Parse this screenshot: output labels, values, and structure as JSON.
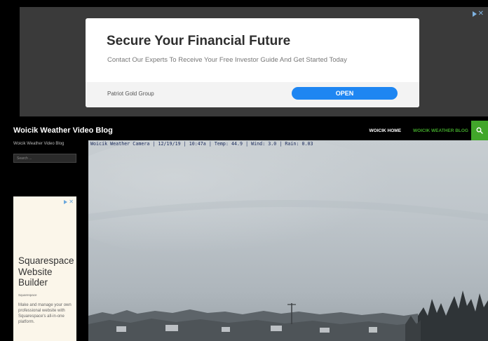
{
  "top_ad": {
    "title": "Secure Your Financial Future",
    "subtitle": "Contact Our Experts To Receive Your Free Investor Guide And Get Started Today",
    "brand": "Patriot Gold Group",
    "cta": "OPEN"
  },
  "header": {
    "site_title": "Woicik Weather Video Blog",
    "nav": [
      {
        "label": "WOICIK HOME"
      },
      {
        "label": "WOICIK WEATHER BLOG"
      }
    ]
  },
  "sidebar": {
    "description": "Woicik Weather Video Blog",
    "search_placeholder": "Search ...",
    "ad": {
      "title": "Squarespace Website Builder",
      "brand": "Squarespace",
      "text": "Make and manage your own professional website with Squarespace's all-in-one platform."
    }
  },
  "camera": {
    "caption": "Woicik Weather Camera | 12/19/19 | 10:47a | Temp: 44.9 | Wind: 3.0 | Rain: 0.03"
  },
  "colors": {
    "accent_green": "#41a62a",
    "cta_blue": "#1e86f2"
  }
}
